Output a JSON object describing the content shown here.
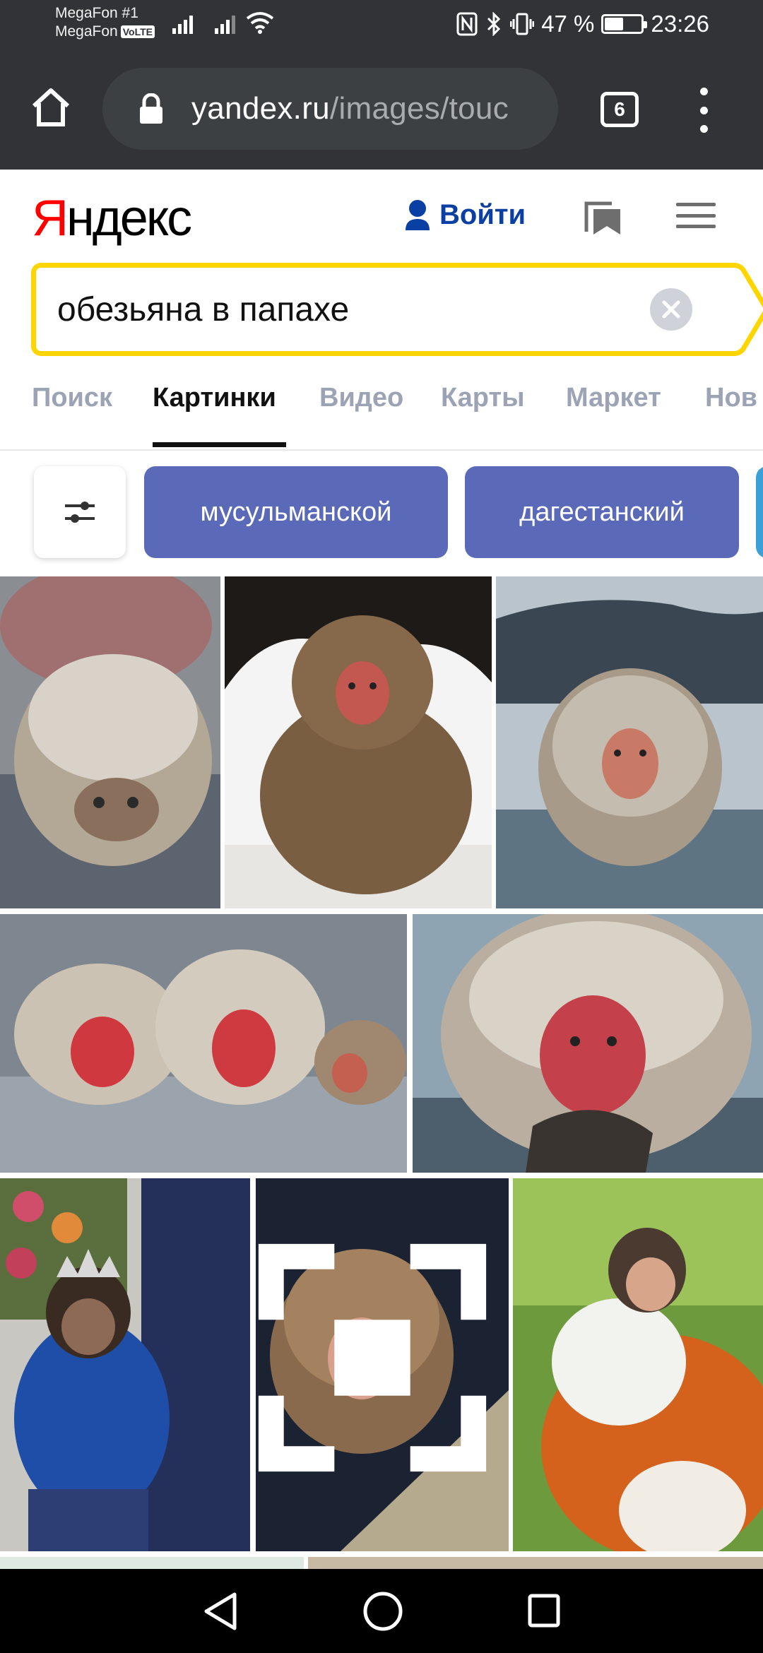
{
  "status_bar": {
    "carrier_1": "MegaFon #1",
    "carrier_2": "MegaFon",
    "volte": "VoLTE",
    "battery_text": "47 %",
    "battery_level": 0.47,
    "time": "23:26"
  },
  "browser": {
    "url_host": "yandex.ru",
    "url_path": "/images/touc",
    "tab_count": "6"
  },
  "header": {
    "logo_first": "Я",
    "logo_rest": "ндекс",
    "login_label": "Войти"
  },
  "search": {
    "query": "обезьяна в папахе"
  },
  "tabs": [
    {
      "label": "Поиск",
      "active": false
    },
    {
      "label": "Картинки",
      "active": true
    },
    {
      "label": "Видео",
      "active": false
    },
    {
      "label": "Карты",
      "active": false
    },
    {
      "label": "Маркет",
      "active": false
    },
    {
      "label": "Нов",
      "active": false
    }
  ],
  "chips": [
    "мусульманской",
    "дагестанский"
  ],
  "colors": {
    "chrome_dark": "#313336",
    "search_border": "#ffd500",
    "chip_bg": "#5b6ab8",
    "login_blue": "#0a3fa3",
    "logo_red": "#ff0000"
  },
  "images": [
    {
      "name": "snow-monkey-snowy-head"
    },
    {
      "name": "young-macaque-in-snow"
    },
    {
      "name": "macaque-in-hot-spring"
    },
    {
      "name": "three-macaques-bathing"
    },
    {
      "name": "macaque-closeup-bathing"
    },
    {
      "name": "chimpanzee-with-crown"
    },
    {
      "name": "macaque-on-rock"
    },
    {
      "name": "baby-monkey-on-toy-lion"
    }
  ]
}
